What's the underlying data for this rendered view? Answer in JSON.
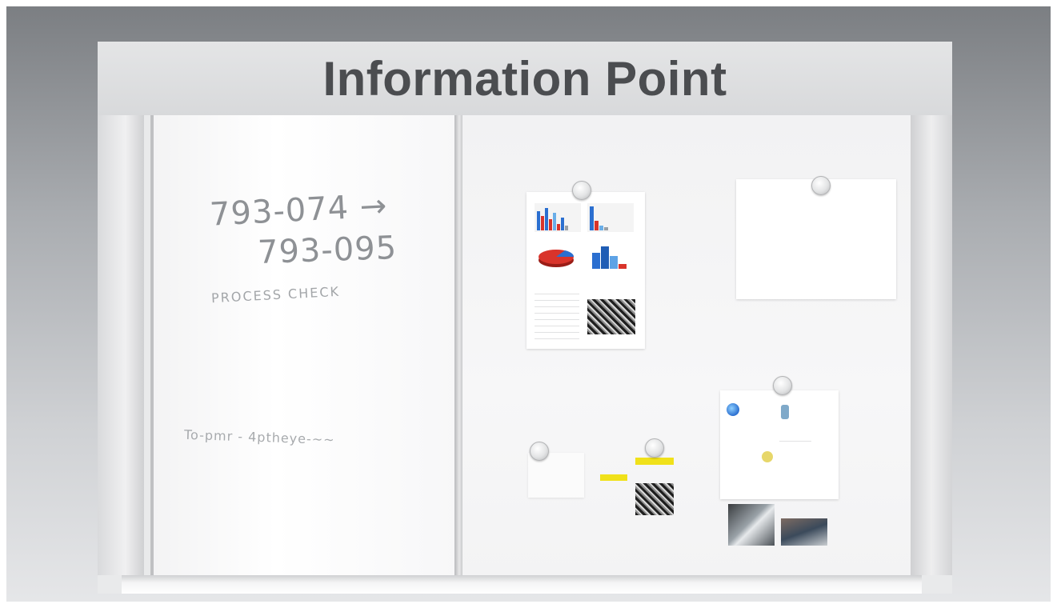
{
  "header": {
    "title": "Information Point"
  },
  "whiteboard": {
    "line1": "793-074 →",
    "line2": "793-095",
    "line3": "PROCESS CHECK",
    "line4": "To-pmr - 4ptheye-~~"
  },
  "colors": {
    "background_top": "#7a7d81",
    "header_text": "#4b4d50",
    "accent_yellow": "#f0e11a",
    "chart_red": "#d9342b",
    "chart_blue": "#2b6fd0"
  },
  "icons": {
    "magnet": "magnet-icon"
  }
}
